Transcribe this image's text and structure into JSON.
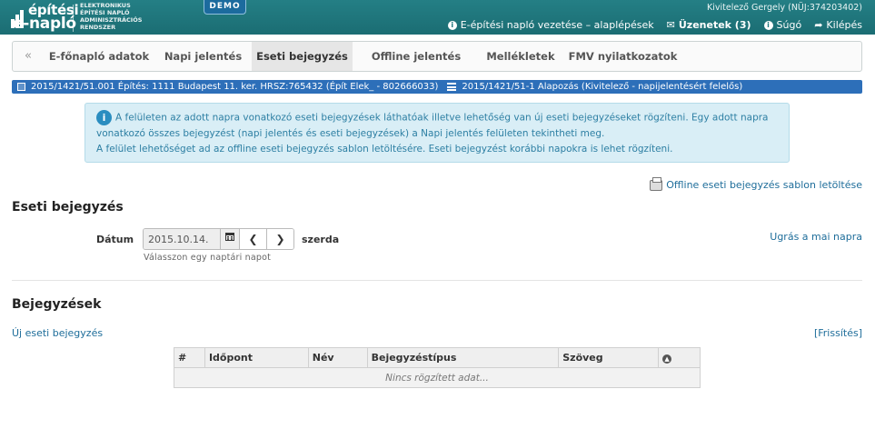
{
  "header": {
    "logo_line1": "építési",
    "logo_line2": "e-napló",
    "logo_sub": [
      "ELEKTRONIKUS",
      "ÉPÍTÉSI NAPLÓ",
      "ADMINISZTRÁCIÓS",
      "RENDSZER"
    ],
    "demo_badge": "DEMO",
    "user": "Kivitelező Gergely (NÜJ:374203402)",
    "links": {
      "guide": "E-építési napló vezetése – alaplépések",
      "messages": "Üzenetek (3)",
      "help": "Súgó",
      "logout": "Kilépés"
    }
  },
  "tabs": {
    "collapse": "«",
    "items": [
      "E-főnapló adatok",
      "Napi jelentés",
      "Eseti bejegyzés",
      "Offline jelentés",
      "Mellékletek",
      "FMV nyilatkozatok"
    ],
    "active": "Eseti bejegyzés"
  },
  "project_bar": {
    "main": "2015/1421/51.001 Építés: 1111 Budapest 11. ker. HRSZ:765432 (Épít Elek_ - 802666033)",
    "sub": "2015/1421/51-1 Alapozás (Kivitelező - napijelentésért felelős)"
  },
  "info": {
    "p1": "A felületen az adott napra vonatkozó eseti bejegyzések láthatóak illetve lehetőség van új eseti bejegyzéseket rögzíteni. Egy adott napra vonatkozó összes bejegyzést (napi jelentés és eseti bejegyzések) a Napi jelentés felületen tekintheti meg.",
    "p2": "A felület lehetőséget ad az offline eseti bejegyzés sablon letöltésére. Eseti bejegyzést korábbi napokra is lehet rögzíteni."
  },
  "offline_template_link": "Offline eseti bejegyzés sablon letöltése",
  "eseti": {
    "title": "Eseti bejegyzés",
    "date_label": "Dátum",
    "date_value": "2015.10.14.",
    "weekday": "szerda",
    "hint": "Válasszon egy naptári napot",
    "goto_today": "Ugrás a mai napra"
  },
  "entries": {
    "title": "Bejegyzések",
    "new_link": "Új eseti bejegyzés",
    "refresh": "[Frissítés]",
    "columns": [
      "#",
      "Időpont",
      "Név",
      "Bejegyzéstípus",
      "Szöveg"
    ],
    "empty": "Nincs rögzített adat..."
  },
  "icons": {
    "calendar": "calendar-icon",
    "prev": "chevron-left-icon",
    "next": "chevron-right-icon",
    "printer": "printer-icon"
  }
}
